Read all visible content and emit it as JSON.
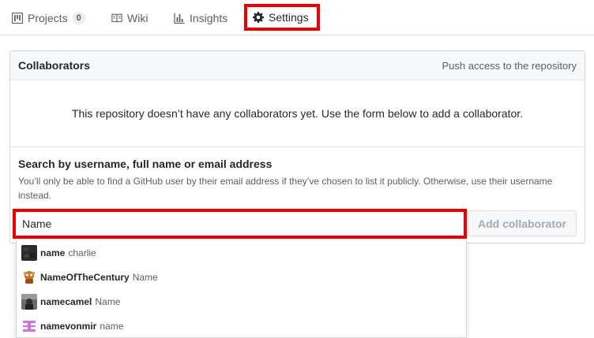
{
  "tabs": {
    "projects": {
      "label": "Projects",
      "count": "0",
      "icon": "project-icon"
    },
    "wiki": {
      "label": "Wiki",
      "icon": "book-icon"
    },
    "insights": {
      "label": "Insights",
      "icon": "graph-icon"
    },
    "settings": {
      "label": "Settings",
      "icon": "gear-icon"
    }
  },
  "collaborators": {
    "title": "Collaborators",
    "note": "Push access to the repository",
    "empty_message": "This repository doesn’t have any collaborators yet. Use the form below to add a collaborator.",
    "search_heading": "Search by username, full name or email address",
    "search_hint": "You’ll only be able to find a GitHub user by their email address if they’ve chosen to list it publicly. Otherwise, use their username instead.",
    "search_value": "Name",
    "add_button": "Add collaborator"
  },
  "suggestions": [
    {
      "login": "name",
      "fullname": "charlie",
      "avatar": "dark-square"
    },
    {
      "login": "NameOfTheCentury",
      "fullname": "Name",
      "avatar": "orange-character"
    },
    {
      "login": "namecamel",
      "fullname": "Name",
      "avatar": "photo"
    },
    {
      "login": "namevonmir",
      "fullname": "name",
      "avatar": "pink-identicon"
    }
  ],
  "colors": {
    "highlight": "#ee0000",
    "accent_pink": "#d36ee5"
  }
}
